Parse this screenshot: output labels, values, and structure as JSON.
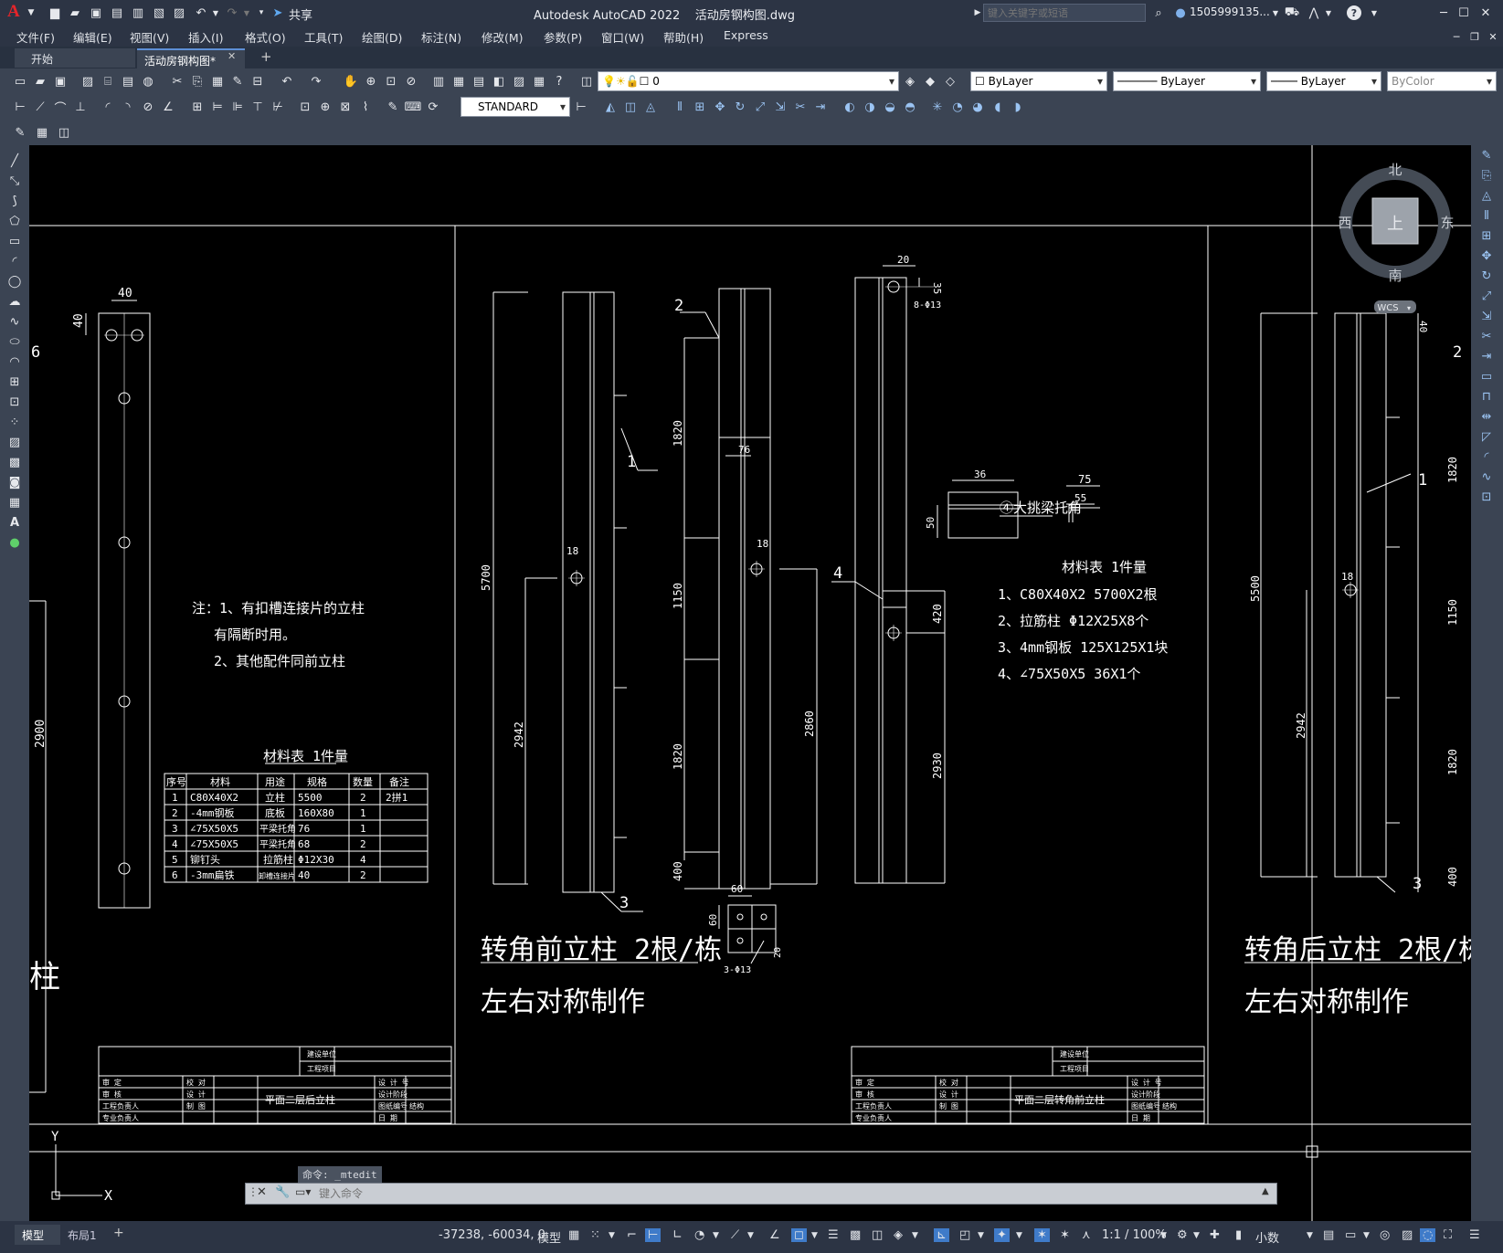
{
  "window": {
    "app_logo": "A",
    "title": "Autodesk AutoCAD 2022",
    "filename": "活动房钢构图.dwg",
    "share_label": "共享",
    "search_placeholder": "键入关键字或短语",
    "user_id": "1505999135...",
    "help_icon": "?"
  },
  "menu": [
    "文件(F)",
    "编辑(E)",
    "视图(V)",
    "插入(I)",
    "格式(O)",
    "工具(T)",
    "绘图(D)",
    "标注(N)",
    "修改(M)",
    "参数(P)",
    "窗口(W)",
    "帮助(H)",
    "Express"
  ],
  "tabs": {
    "start": "开始",
    "active": "活动房钢构图*",
    "close": "✕",
    "add": "+"
  },
  "layer": {
    "name": "0"
  },
  "props": {
    "color": "ByLayer",
    "linetype": "ByLayer",
    "lineweight": "ByLayer",
    "plotstyle": "ByColor"
  },
  "textstyle": "STANDARD",
  "viewcube": {
    "north": "北",
    "south": "南",
    "east": "东",
    "west": "西",
    "face": "上",
    "wcs": "WCS"
  },
  "drawing": {
    "left_note": [
      "注：1、有扣槽连接片的立柱",
      "有隔断时用。",
      "2、其他配件同前立柱"
    ],
    "left_table": {
      "title": "材料表 1件量",
      "headers": [
        "序号",
        "材料",
        "用途",
        "规格",
        "数量",
        "备注"
      ],
      "rows": [
        [
          "1",
          "C80X40X2",
          "立柱",
          "5500",
          "2",
          "2拼1"
        ],
        [
          "2",
          "-4mm钢板",
          "底板",
          "160X80",
          "1",
          ""
        ],
        [
          "3",
          "∠75X50X5",
          "平梁托角",
          "76",
          "1",
          ""
        ],
        [
          "4",
          "∠75X50X5",
          "平梁托角",
          "68",
          "2",
          ""
        ],
        [
          "5",
          "铆钉头",
          "拉筋柱",
          "Φ12X30",
          "4",
          ""
        ],
        [
          "6",
          "-3mm扁铁",
          "卸槽连接片",
          "40",
          "2",
          ""
        ]
      ]
    },
    "mid_table": {
      "title": "材料表 1件量",
      "items": [
        "1、C80X40X2  5700X2根",
        "2、拉筋柱   Φ12X25X8个",
        "3、4mm钢板   125X125X1块",
        "4、∠75X50X5  36X1个"
      ]
    },
    "bracket_label": "④大挑梁托角",
    "title_front": "转角前立柱 2根/栋",
    "title_back": "转角后立柱 2根/栋",
    "subtitle": "左右对称制作",
    "side_title": "柱",
    "tb_left": "平面二层后立柱",
    "tb_mid": "平面二层转角前立柱",
    "tb_labels": {
      "build_unit": "建设单位",
      "project": "工程项目",
      "r1": "审   定",
      "r2": "审   核",
      "r3": "工程负责人",
      "r4": "专业负责人",
      "c1": "校 对",
      "c2": "设 计",
      "c3": "制 图",
      "d1": "设 计 号",
      "d2": "设计阶段",
      "d3": "图纸编号",
      "d4": "日    期",
      "struct": "结构"
    },
    "dims": {
      "d40a": "40",
      "d40b": "40",
      "d2900": "2900",
      "d6": "6",
      "d2a": "2",
      "d5700": "5700",
      "d2942a": "2942",
      "d18a": "18",
      "d1": "1",
      "d3": "3",
      "d2": "2",
      "d1820a": "1820",
      "d1150a": "1150",
      "d1820b": "1820",
      "d400a": "400",
      "d76": "76",
      "d18b": "18",
      "d2860": "2860",
      "d20": "20",
      "d35": "35",
      "d8013": "8-Φ13",
      "d4": "4",
      "d420": "420",
      "d2930": "2930",
      "d36": "36",
      "d50": "50",
      "d75": "75",
      "d55": "55",
      "d60a": "60",
      "d60b": "60",
      "d20b": "20",
      "d3013": "3-Φ13",
      "d5500": "5500",
      "d2942b": "2942",
      "d18c": "18",
      "d1b": "1",
      "d3b": "3",
      "d40c": "40",
      "d1820c": "1820",
      "d1150b": "1150",
      "d1820d": "1820",
      "d400b": "400",
      "ucs_y": "Y",
      "ucs_x": "X"
    }
  },
  "command": {
    "history": "命令:  _mtedit",
    "placeholder": "键入命令"
  },
  "layout_tabs": {
    "model": "模型",
    "layout1": "布局1",
    "add": "+"
  },
  "status": {
    "coords": "-37238, -60034, 0",
    "model": "模型",
    "scale": "1:1 / 100%",
    "units": "小数"
  }
}
